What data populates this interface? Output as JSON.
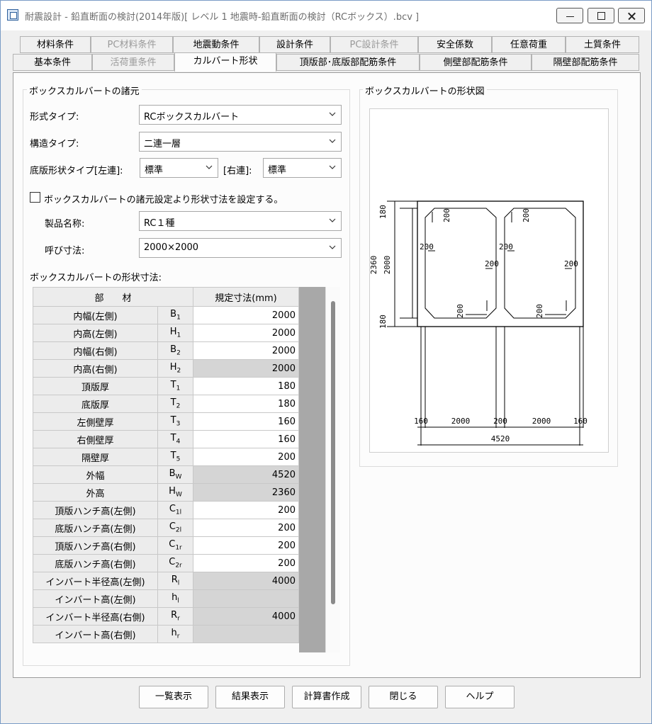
{
  "window": {
    "title": "耐震設計 - 鉛直断面の検討(2014年版)[ レベル 1 地震時-鉛直断面の検討（RCボックス）.bcv ]"
  },
  "tabs_row1": [
    {
      "label": "材料条件",
      "disabled": false
    },
    {
      "label": "PC材料条件",
      "disabled": true
    },
    {
      "label": "地震動条件",
      "disabled": false
    },
    {
      "label": "設計条件",
      "disabled": false
    },
    {
      "label": "PC設計条件",
      "disabled": true
    },
    {
      "label": "安全係数",
      "disabled": false
    },
    {
      "label": "任意荷重",
      "disabled": false
    },
    {
      "label": "土質条件",
      "disabled": false
    }
  ],
  "tabs_row2": [
    {
      "label": "基本条件",
      "disabled": false
    },
    {
      "label": "活荷重条件",
      "disabled": true
    },
    {
      "label": "カルバート形状",
      "active": true
    },
    {
      "label": "頂版部･底版部配筋条件",
      "disabled": false
    },
    {
      "label": "側壁部配筋条件",
      "disabled": false
    },
    {
      "label": "隔壁部配筋条件",
      "disabled": false
    }
  ],
  "specs": {
    "group_title": "ボックスカルバートの諸元",
    "form_type_label": "形式タイプ:",
    "form_type_value": "RCボックスカルバート",
    "struct_type_label": "構造タイプ:",
    "struct_type_value": "二連一層",
    "bottom_shape_label": "底版形状タイプ[左連]:",
    "bottom_left_value": "標準",
    "right_label": "[右連]:",
    "bottom_right_value": "標準",
    "checkbox_label": "ボックスカルバートの諸元設定より形状寸法を設定する。",
    "checkbox_checked": false,
    "product_label": "製品名称:",
    "product_value": "RC１種",
    "nominal_label": "呼び寸法:",
    "nominal_value": "2000×2000",
    "dims_title": "ボックスカルバートの形状寸法:"
  },
  "table": {
    "header_member": "部　　材",
    "header_value": "規定寸法(mm)",
    "rows": [
      {
        "name": "内幅(左側)",
        "sym": "B",
        "sub": "1",
        "value": "2000",
        "gray": false
      },
      {
        "name": "内高(左側)",
        "sym": "H",
        "sub": "1",
        "value": "2000",
        "gray": false
      },
      {
        "name": "内幅(右側)",
        "sym": "B",
        "sub": "2",
        "value": "2000",
        "gray": false
      },
      {
        "name": "内高(右側)",
        "sym": "H",
        "sub": "2",
        "value": "2000",
        "gray": true
      },
      {
        "name": "頂版厚",
        "sym": "T",
        "sub": "1",
        "value": "180",
        "gray": false
      },
      {
        "name": "底版厚",
        "sym": "T",
        "sub": "2",
        "value": "180",
        "gray": false
      },
      {
        "name": "左側壁厚",
        "sym": "T",
        "sub": "3",
        "value": "160",
        "gray": false
      },
      {
        "name": "右側壁厚",
        "sym": "T",
        "sub": "4",
        "value": "160",
        "gray": false
      },
      {
        "name": "隔壁厚",
        "sym": "T",
        "sub": "5",
        "value": "200",
        "gray": false
      },
      {
        "name": "外幅",
        "sym": "B",
        "sub": "W",
        "value": "4520",
        "gray": true
      },
      {
        "name": "外高",
        "sym": "H",
        "sub": "W",
        "value": "2360",
        "gray": true
      },
      {
        "name": "頂版ハンチ高(左側)",
        "sym": "C",
        "sub": "1l",
        "value": "200",
        "gray": false
      },
      {
        "name": "底版ハンチ高(左側)",
        "sym": "C",
        "sub": "2l",
        "value": "200",
        "gray": false
      },
      {
        "name": "頂版ハンチ高(右側)",
        "sym": "C",
        "sub": "1r",
        "value": "200",
        "gray": false
      },
      {
        "name": "底版ハンチ高(右側)",
        "sym": "C",
        "sub": "2r",
        "value": "200",
        "gray": false
      },
      {
        "name": "インバート半径高(左側)",
        "sym": "R",
        "sub": "l",
        "value": "4000",
        "gray": true
      },
      {
        "name": "インバート高(左側)",
        "sym": "h",
        "sub": "l",
        "value": "",
        "gray": true
      },
      {
        "name": "インバート半径高(右側)",
        "sym": "R",
        "sub": "r",
        "value": "4000",
        "gray": true
      },
      {
        "name": "インバート高(右側)",
        "sym": "h",
        "sub": "r",
        "value": "",
        "gray": true
      }
    ]
  },
  "figure": {
    "group_title": "ボックスカルバートの形状図",
    "dims": {
      "top_slab": "180",
      "bottom_slab": "180",
      "inner_height": "2000",
      "outer_height": "2360",
      "haunch": "200",
      "left_wall": "160",
      "right_wall": "160",
      "inner_width": "2000",
      "partition": "200",
      "outer_width": "4520"
    }
  },
  "buttons": {
    "list": "一覧表示",
    "result": "結果表示",
    "report": "計算書作成",
    "close": "閉じる",
    "help": "ヘルプ"
  }
}
